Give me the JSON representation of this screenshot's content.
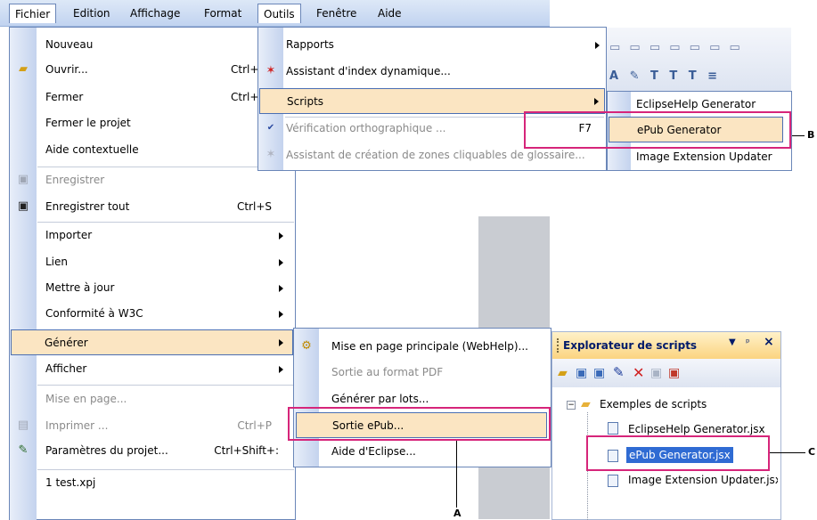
{
  "menubar": {
    "items": [
      "Fichier",
      "Edition",
      "Affichage",
      "Format",
      "Outils",
      "Fenêtre",
      "Aide"
    ]
  },
  "fichier": {
    "items": [
      {
        "label": "Nouveau",
        "shortcut": ""
      },
      {
        "label": "Ouvrir...",
        "shortcut": "Ctrl+"
      },
      {
        "label": "Fermer",
        "shortcut": "Ctrl+"
      },
      {
        "label": "Fermer le projet",
        "shortcut": ""
      },
      {
        "label": "Aide contextuelle",
        "shortcut": ""
      },
      {
        "label": "Enregistrer",
        "shortcut": ""
      },
      {
        "label": "Enregistrer tout",
        "shortcut": "Ctrl+S"
      },
      {
        "label": "Importer",
        "shortcut": ""
      },
      {
        "label": "Lien",
        "shortcut": ""
      },
      {
        "label": "Mettre à jour",
        "shortcut": ""
      },
      {
        "label": "Conformité à W3C",
        "shortcut": ""
      },
      {
        "label": "Générer",
        "shortcut": ""
      },
      {
        "label": "Afficher",
        "shortcut": ""
      },
      {
        "label": "Mise en page...",
        "shortcut": ""
      },
      {
        "label": "Imprimer ...",
        "shortcut": "Ctrl+P"
      },
      {
        "label": "Paramètres du projet...",
        "shortcut": "Ctrl+Shift+:"
      },
      {
        "label": "1 test.xpj",
        "shortcut": ""
      }
    ]
  },
  "outils": {
    "items": [
      {
        "label": "Rapports",
        "shortcut": ""
      },
      {
        "label": "Assistant d'index dynamique...",
        "shortcut": ""
      },
      {
        "label": "Scripts",
        "shortcut": ""
      },
      {
        "label": "Vérification orthographique ...",
        "shortcut": "F7"
      },
      {
        "label": "Assistant de création de zones cliquables de glossaire...",
        "shortcut": ""
      }
    ]
  },
  "scripts_menu": {
    "items": [
      "EclipseHelp Generator",
      "ePub Generator",
      "Image Extension Updater"
    ]
  },
  "generer_menu": {
    "items": [
      "Mise en page principale (WebHelp)...",
      "Sortie au format PDF",
      "Générer par lots...",
      "Sortie ePub...",
      "Aide d'Eclipse..."
    ]
  },
  "explorer": {
    "title": "Explorateur de scripts",
    "pin": "ᵖ",
    "close": "×",
    "folder": "Exemples de scripts",
    "files": [
      "EclipseHelp Generator.jsx",
      "ePub Generator.jsx",
      "Image Extension Updater.jsx"
    ]
  },
  "callouts": {
    "a": "A",
    "b": "B",
    "c": "C"
  },
  "colors": {
    "highlight": "#fbe5c2",
    "callout_border": "#d6257a",
    "menubar": "#c1d3f0"
  }
}
